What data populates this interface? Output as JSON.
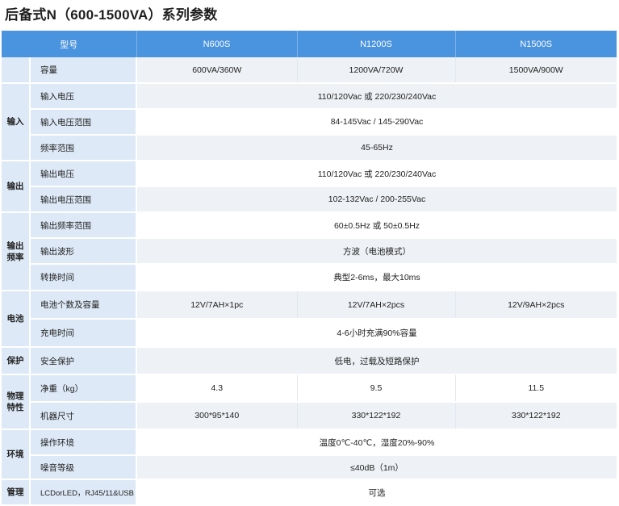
{
  "title": "后备式N（600-1500VA）系列参数",
  "header": {
    "model_label": "型号",
    "models": [
      "N600S",
      "N1200S",
      "N1500S"
    ]
  },
  "rows": {
    "capacity": {
      "label": "容量",
      "values": [
        "600VA/360W",
        "1200VA/720W",
        "1500VA/900W"
      ]
    },
    "input": {
      "group": "输入",
      "voltage": {
        "label": "输入电压",
        "value": "110/120Vac 或 220/230/240Vac"
      },
      "voltage_range": {
        "label": "输入电压范围",
        "value": "84-145Vac  /  145-290Vac"
      },
      "freq_range": {
        "label": "频率范围",
        "value": "45-65Hz"
      }
    },
    "output": {
      "group": "输出",
      "voltage": {
        "label": "输出电压",
        "value": "110/120Vac 或 220/230/240Vac"
      },
      "voltage_range": {
        "label": "输出电压范围",
        "value": "102-132Vac / 200-255Vac"
      }
    },
    "output_freq": {
      "group_line1": "输出",
      "group_line2": "频率",
      "freq_range": {
        "label": "输出频率范围",
        "value": "60±0.5Hz 或 50±0.5Hz"
      },
      "waveform": {
        "label": "输出波形",
        "value": "方波（电池模式）"
      },
      "transfer_time": {
        "label": "转换时间",
        "value": "典型2-6ms，最大10ms"
      }
    },
    "battery": {
      "group": "电池",
      "count": {
        "label": "电池个数及容量",
        "values": [
          "12V/7AH×1pc",
          "12V/7AH×2pcs",
          "12V/9AH×2pcs"
        ]
      },
      "charge_time": {
        "label": "充电时间",
        "value": "4-6小时充满90%容量"
      }
    },
    "protection": {
      "group": "保护",
      "safety": {
        "label": "安全保护",
        "value": "低电，过载及短路保护"
      }
    },
    "physical": {
      "group_line1": "物理",
      "group_line2": "特性",
      "weight": {
        "label": "净重（kg）",
        "values": [
          "4.3",
          "9.5",
          "11.5"
        ]
      },
      "dimensions": {
        "label": "机器尺寸",
        "values": [
          "300*95*140",
          "330*122*192",
          "330*122*192"
        ]
      }
    },
    "environment": {
      "group": "环境",
      "operating": {
        "label": "操作环境",
        "value": "温度0℃-40℃，湿度20%-90%"
      },
      "noise": {
        "label": "噪音等级",
        "value": "≤40dB（1m）"
      }
    },
    "management": {
      "group": "管理",
      "interface": {
        "label": "LCDorLED，RJ45/11&USB",
        "value": "可选"
      }
    }
  }
}
